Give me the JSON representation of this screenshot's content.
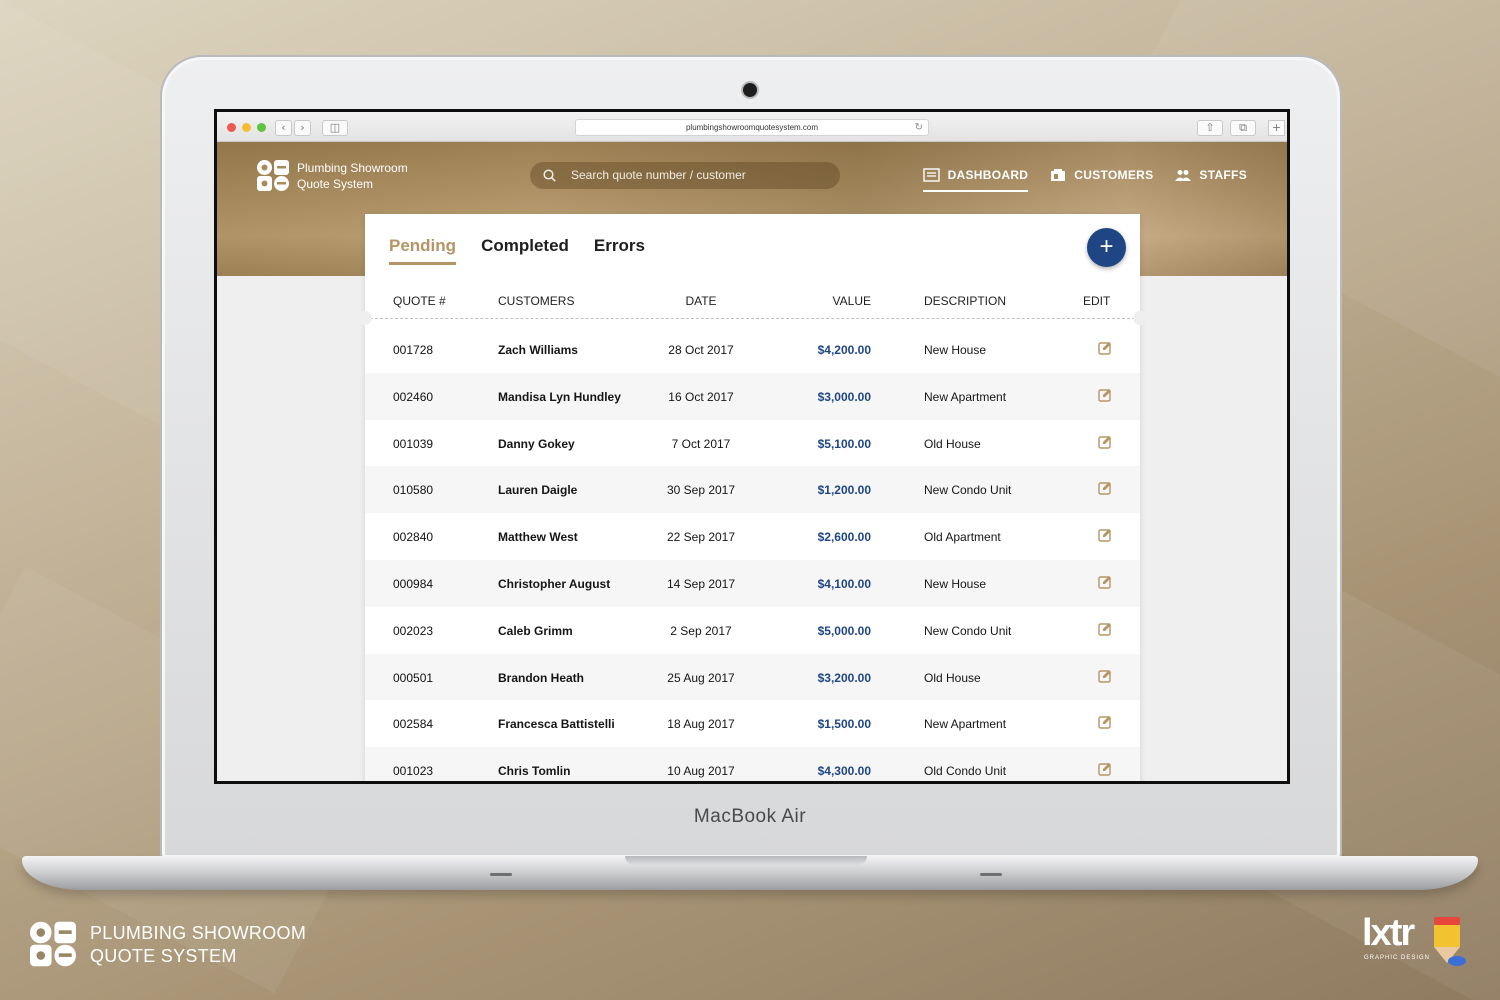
{
  "browser": {
    "url": "plumbingshowroomquotesystem.com",
    "traffic_lights": [
      "#ee5a52",
      "#f5bd2f",
      "#5fc43f"
    ]
  },
  "app": {
    "brand_line1": "Plumbing Showroom",
    "brand_line2": "Quote System",
    "search_placeholder": "Search quote number / customer",
    "nav": [
      {
        "label": "DASHBOARD",
        "icon": "dashboard-icon",
        "active": true
      },
      {
        "label": "CUSTOMERS",
        "icon": "customers-icon",
        "active": false
      },
      {
        "label": "STAFFS",
        "icon": "staffs-icon",
        "active": false
      }
    ]
  },
  "card": {
    "tabs": [
      {
        "label": "Pending",
        "active": true
      },
      {
        "label": "Completed",
        "active": false
      },
      {
        "label": "Errors",
        "active": false
      }
    ],
    "add_button": "+",
    "columns": {
      "quote": "QUOTE #",
      "customers": "CUSTOMERS",
      "date": "DATE",
      "value": "VALUE",
      "description": "DESCRIPTION",
      "edit": "EDIT"
    },
    "rows": [
      {
        "quote": "001728",
        "customer": "Zach Williams",
        "date": "28 Oct 2017",
        "value": "$4,200.00",
        "description": "New House"
      },
      {
        "quote": "002460",
        "customer": "Mandisa Lyn Hundley",
        "date": "16 Oct 2017",
        "value": "$3,000.00",
        "description": "New Apartment"
      },
      {
        "quote": "001039",
        "customer": "Danny Gokey",
        "date": "7 Oct 2017",
        "value": "$5,100.00",
        "description": "Old House"
      },
      {
        "quote": "010580",
        "customer": "Lauren Daigle",
        "date": "30 Sep 2017",
        "value": "$1,200.00",
        "description": "New Condo Unit"
      },
      {
        "quote": "002840",
        "customer": "Matthew West",
        "date": "22 Sep 2017",
        "value": "$2,600.00",
        "description": "Old Apartment"
      },
      {
        "quote": "000984",
        "customer": "Christopher August",
        "date": "14 Sep 2017",
        "value": "$4,100.00",
        "description": "New House"
      },
      {
        "quote": "002023",
        "customer": "Caleb Grimm",
        "date": "2 Sep 2017",
        "value": "$5,000.00",
        "description": "New Condo Unit"
      },
      {
        "quote": "000501",
        "customer": "Brandon Heath",
        "date": "25 Aug 2017",
        "value": "$3,200.00",
        "description": "Old House"
      },
      {
        "quote": "002584",
        "customer": "Francesca Battistelli",
        "date": "18 Aug 2017",
        "value": "$1,500.00",
        "description": "New Apartment"
      },
      {
        "quote": "001023",
        "customer": "Chris Tomlin",
        "date": "10 Aug 2017",
        "value": "$4,300.00",
        "description": "Old Condo Unit"
      }
    ]
  },
  "device_label": "MacBook Air",
  "footer": {
    "title_line1": "PLUMBING SHOWROOM",
    "title_line2": "QUOTE SYSTEM",
    "agency_name": "lxtr",
    "agency_sub": "GRAPHIC DESIGN"
  },
  "colors": {
    "accent_gold": "#b59566",
    "primary_blue": "#1f4585",
    "header_brown": "#a98b5a"
  }
}
